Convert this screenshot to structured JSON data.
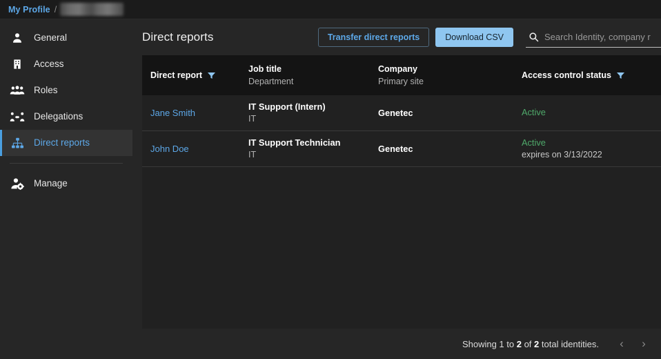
{
  "breadcrumb": {
    "root_label": "My Profile",
    "separator": "/",
    "current_redacted": true
  },
  "sidebar": {
    "items": [
      {
        "id": "general",
        "label": "General",
        "icon": "user-icon",
        "active": false
      },
      {
        "id": "access",
        "label": "Access",
        "icon": "building-icon",
        "active": false
      },
      {
        "id": "roles",
        "label": "Roles",
        "icon": "people-group-icon",
        "active": false
      },
      {
        "id": "delegations",
        "label": "Delegations",
        "icon": "delegation-icon",
        "active": false
      },
      {
        "id": "direct-reports",
        "label": "Direct reports",
        "icon": "org-chart-icon",
        "active": true
      }
    ],
    "footer_items": [
      {
        "id": "manage",
        "label": "Manage",
        "icon": "user-gear-icon",
        "active": false
      }
    ]
  },
  "header": {
    "title": "Direct reports",
    "transfer_button_label": "Transfer direct reports",
    "download_button_label": "Download CSV"
  },
  "search": {
    "placeholder": "Search Identity, company r",
    "value": "",
    "icon": "search-icon"
  },
  "table": {
    "columns": [
      {
        "key": "direct_report",
        "header": "Direct report",
        "subheader": "",
        "filterable": true
      },
      {
        "key": "job_title",
        "header": "Job title",
        "subheader": "Department",
        "filterable": false
      },
      {
        "key": "company",
        "header": "Company",
        "subheader": "Primary site",
        "filterable": false
      },
      {
        "key": "status",
        "header": "Access control status",
        "subheader": "",
        "filterable": true
      }
    ],
    "rows": [
      {
        "direct_report": "Jane Smith",
        "job_title": "IT Support (Intern)",
        "department": "IT",
        "company": "Genetec",
        "primary_site": "",
        "status": "Active",
        "status_detail": ""
      },
      {
        "direct_report": "John Doe",
        "job_title": "IT Support Technician",
        "department": "IT",
        "company": "Genetec",
        "primary_site": "",
        "status": "Active",
        "status_detail": "expires on 3/13/2022"
      }
    ]
  },
  "footer": {
    "showing_prefix": "Showing 1 to ",
    "showing_to": "2",
    "showing_mid": " of ",
    "showing_total": "2",
    "showing_suffix": " total identities.",
    "prev_label": "‹",
    "next_label": "›"
  },
  "colors": {
    "accent_blue": "#5da8e8",
    "button_fill": "#8fc6f0",
    "status_active_green": "#4faa6b",
    "sidebar_bg": "#262626",
    "table_header_bg": "#141414",
    "table_row_bg": "#212121"
  }
}
